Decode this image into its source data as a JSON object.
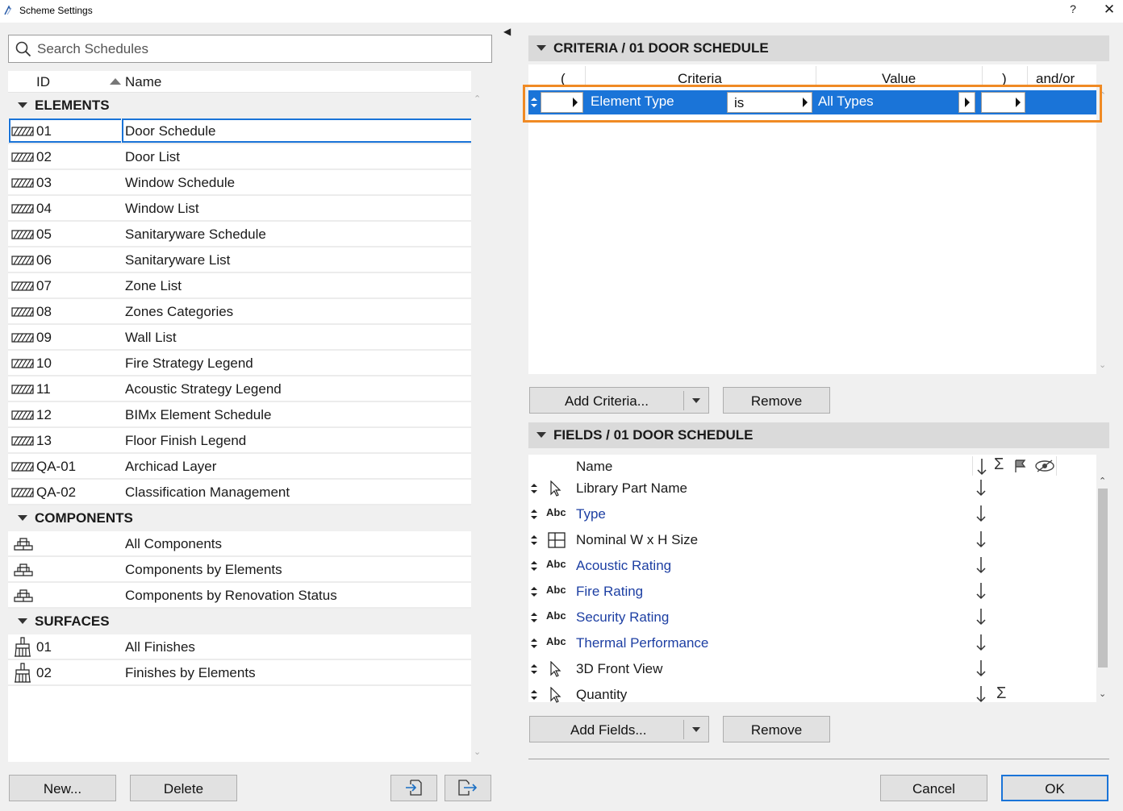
{
  "window": {
    "title": "Scheme Settings",
    "help_label": "?",
    "close_label": "✕"
  },
  "search": {
    "placeholder": "Search Schedules"
  },
  "list": {
    "col_id": "ID",
    "col_name": "Name",
    "groups": {
      "elements": "ELEMENTS",
      "components": "COMPONENTS",
      "surfaces": "SURFACES"
    },
    "elements": [
      {
        "id": "01",
        "name": "Door Schedule"
      },
      {
        "id": "02",
        "name": "Door List"
      },
      {
        "id": "03",
        "name": "Window Schedule"
      },
      {
        "id": "04",
        "name": "Window List"
      },
      {
        "id": "05",
        "name": "Sanitaryware Schedule"
      },
      {
        "id": "06",
        "name": "Sanitaryware List"
      },
      {
        "id": "07",
        "name": "Zone List"
      },
      {
        "id": "08",
        "name": "Zones Categories"
      },
      {
        "id": "09",
        "name": "Wall List"
      },
      {
        "id": "10",
        "name": "Fire Strategy Legend"
      },
      {
        "id": "11",
        "name": "Acoustic Strategy Legend"
      },
      {
        "id": "12",
        "name": "BIMx Element Schedule"
      },
      {
        "id": "13",
        "name": "Floor Finish Legend"
      },
      {
        "id": "QA-01",
        "name": "Archicad Layer"
      },
      {
        "id": "QA-02",
        "name": "Classification Management"
      }
    ],
    "components": [
      {
        "id": "",
        "name": "All Components"
      },
      {
        "id": "",
        "name": "Components by Elements"
      },
      {
        "id": "",
        "name": "Components by Renovation Status"
      }
    ],
    "surfaces": [
      {
        "id": "01",
        "name": "All Finishes"
      },
      {
        "id": "02",
        "name": "Finishes by Elements"
      }
    ],
    "selected_index": 0
  },
  "left_buttons": {
    "new": "New...",
    "delete": "Delete",
    "import_icon": "import-icon",
    "export_icon": "export-icon"
  },
  "criteria": {
    "header": "CRITERIA / 01 DOOR SCHEDULE",
    "columns": {
      "open_paren": "(",
      "criteria": "Criteria",
      "value": "Value",
      "close_paren": ")",
      "andor": "and/or"
    },
    "row": {
      "criteria": "Element Type",
      "operator": "is",
      "value": "All Types"
    },
    "add_button": "Add Criteria...",
    "remove_button": "Remove"
  },
  "fields": {
    "header": "FIELDS / 01 DOOR SCHEDULE",
    "col_name": "Name",
    "items": [
      {
        "name": "Library Part Name",
        "icon": "cursor-icon",
        "linked": false,
        "sum": false
      },
      {
        "name": "Type",
        "icon": "abc-icon",
        "icon_text": "Abc",
        "linked": true,
        "sum": false
      },
      {
        "name": "Nominal W x H Size",
        "icon": "window-frame-icon",
        "linked": false,
        "sum": false
      },
      {
        "name": "Acoustic Rating",
        "icon": "abc-icon",
        "icon_text": "Abc",
        "linked": true,
        "sum": false
      },
      {
        "name": "Fire Rating",
        "icon": "abc-icon",
        "icon_text": "Abc",
        "linked": true,
        "sum": false
      },
      {
        "name": "Security Rating",
        "icon": "abc-icon",
        "icon_text": "Abc",
        "linked": true,
        "sum": false
      },
      {
        "name": "Thermal Performance",
        "icon": "abc-icon",
        "icon_text": "Abc",
        "linked": true,
        "sum": false
      },
      {
        "name": "3D Front View",
        "icon": "cursor-icon",
        "linked": false,
        "sum": false
      },
      {
        "name": "Quantity",
        "icon": "cursor-icon",
        "linked": false,
        "sum": true
      }
    ],
    "add_button": "Add Fields...",
    "remove_button": "Remove"
  },
  "dialog_buttons": {
    "cancel": "Cancel",
    "ok": "OK"
  },
  "colors": {
    "selection": "#1a74d8",
    "highlight": "#f08a24",
    "link_text": "#1d3fa3"
  }
}
